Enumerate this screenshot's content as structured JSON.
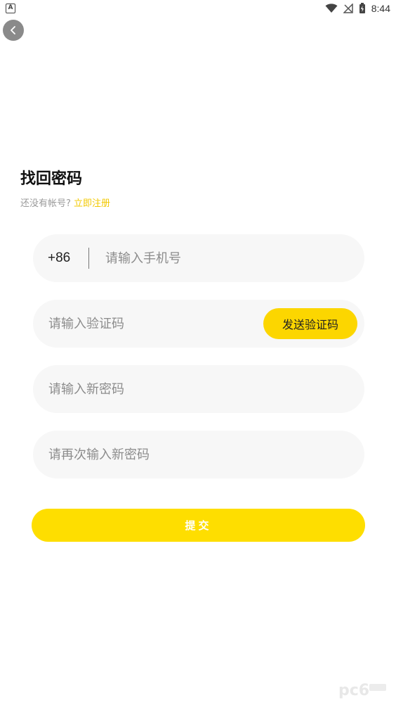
{
  "status_bar": {
    "time": "8:44",
    "app_icon_letter": "A",
    "icons": [
      "wifi-icon",
      "signal-icon",
      "battery-icon"
    ]
  },
  "header": {
    "back_icon": "chevron-left-icon"
  },
  "page": {
    "title": "找回密码",
    "subtitle_prefix": "还没有帐号?",
    "register_link": "立即注册"
  },
  "form": {
    "country_code": "+86",
    "phone_placeholder": "请输入手机号",
    "code_placeholder": "请输入验证码",
    "send_code_label": "发送验证码",
    "new_password_placeholder": "请输入新密码",
    "confirm_password_placeholder": "请再次输入新密码",
    "submit_label": "提交"
  },
  "colors": {
    "accent": "#fede00",
    "link": "#f2c800",
    "field_bg": "#f7f7f7"
  }
}
